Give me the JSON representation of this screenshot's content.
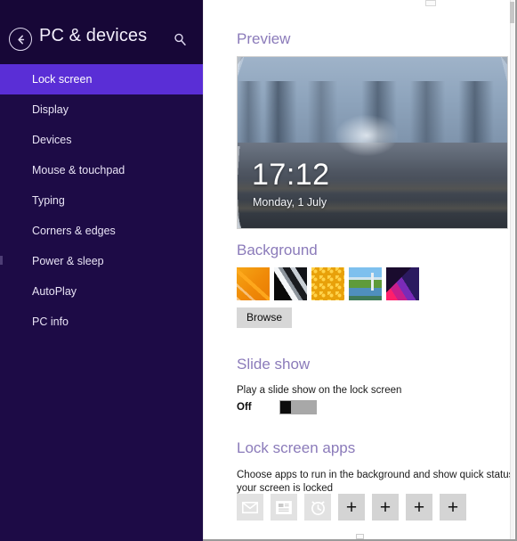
{
  "nav": {
    "title": "PC & devices",
    "back_icon": "back-arrow-icon",
    "search_icon": "search-icon",
    "items": [
      {
        "label": "Lock screen",
        "selected": true
      },
      {
        "label": "Display",
        "selected": false
      },
      {
        "label": "Devices",
        "selected": false
      },
      {
        "label": "Mouse & touchpad",
        "selected": false
      },
      {
        "label": "Typing",
        "selected": false
      },
      {
        "label": "Corners & edges",
        "selected": false
      },
      {
        "label": "Power & sleep",
        "selected": false
      },
      {
        "label": "AutoPlay",
        "selected": false
      },
      {
        "label": "PC info",
        "selected": false
      }
    ]
  },
  "preview": {
    "heading": "Preview",
    "clock": "17:12",
    "date": "Monday, 1 July",
    "image_description": "motion-blurred city tunnel with converging rails"
  },
  "background": {
    "heading": "Background",
    "thumbnails": [
      {
        "name": "orange-geometric",
        "selected": true
      },
      {
        "name": "black-white-diagonal",
        "selected": false
      },
      {
        "name": "yellow-honeycomb",
        "selected": false
      },
      {
        "name": "blue-landscape",
        "selected": false
      },
      {
        "name": "magenta-green-abstract",
        "selected": false
      }
    ],
    "browse_label": "Browse"
  },
  "slide_show": {
    "heading": "Slide show",
    "description": "Play a slide show on the lock screen",
    "toggle_state": "Off",
    "toggle_on": false
  },
  "lock_screen_apps": {
    "heading": "Lock screen apps",
    "description_line1": "Choose apps to run in the background and show quick status and notifica",
    "description_line2": "your screen is locked",
    "apps": [
      {
        "name": "mail-app-tile",
        "icon": "envelope-icon",
        "empty": false
      },
      {
        "name": "calendar-app-tile",
        "icon": "calendar-icon",
        "empty": false
      },
      {
        "name": "alarm-app-tile",
        "icon": "alarm-clock-icon",
        "empty": false
      },
      {
        "name": "add-app-tile-1",
        "icon": "plus-icon",
        "empty": true
      },
      {
        "name": "add-app-tile-2",
        "icon": "plus-icon",
        "empty": true
      },
      {
        "name": "add-app-tile-3",
        "icon": "plus-icon",
        "empty": true
      },
      {
        "name": "add-app-tile-4",
        "icon": "plus-icon",
        "empty": true
      }
    ],
    "add_label": "+"
  },
  "colors": {
    "nav_background": "#1d0b46",
    "nav_header": "#170737",
    "nav_selected": "#5a2ed6",
    "heading_purple": "#8b7bba",
    "content_background": "#ffffff",
    "button_gray": "#d7d7d7",
    "tile_gray": "#dcdcdc",
    "toggle_track": "#a8a8a8",
    "toggle_thumb": "#0d0d0d"
  }
}
